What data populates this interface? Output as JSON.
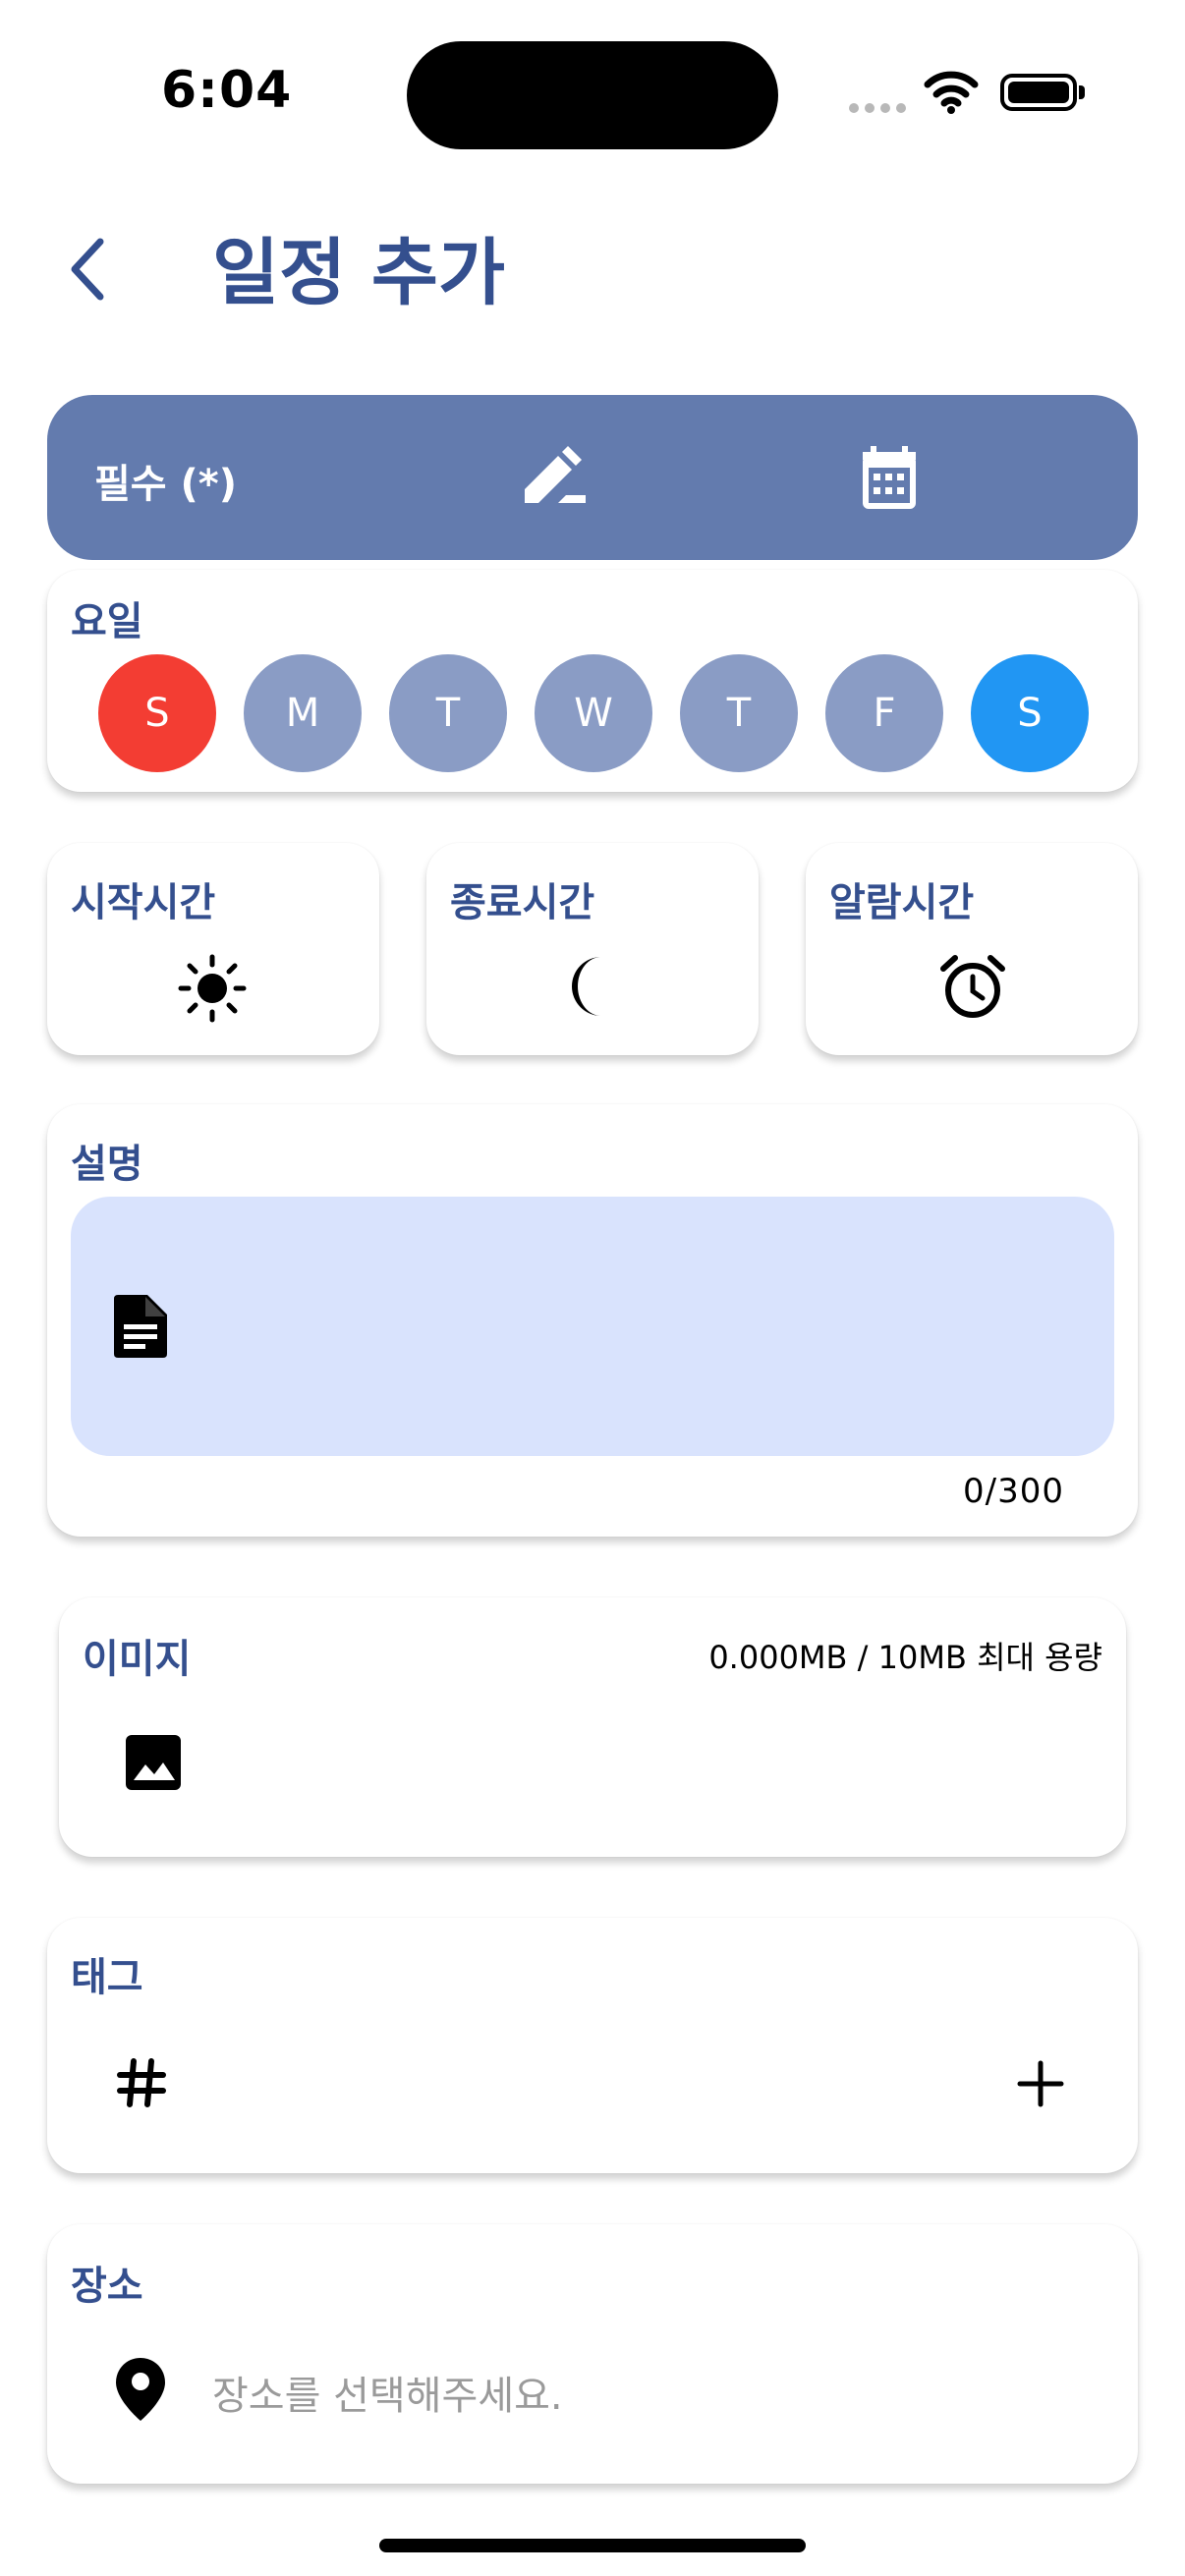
{
  "status_bar": {
    "time": "6:04"
  },
  "header": {
    "title": "일정 추가"
  },
  "required_bar": {
    "label": "필수 (*)"
  },
  "days": {
    "label": "요일",
    "items": [
      {
        "letter": "S",
        "color": "#f33d33"
      },
      {
        "letter": "M",
        "color": "#8a9cc5"
      },
      {
        "letter": "T",
        "color": "#8a9cc5"
      },
      {
        "letter": "W",
        "color": "#8a9cc5"
      },
      {
        "letter": "T",
        "color": "#8a9cc5"
      },
      {
        "letter": "F",
        "color": "#8a9cc5"
      },
      {
        "letter": "S",
        "color": "#2196f3"
      }
    ]
  },
  "times": {
    "start_label": "시작시간",
    "end_label": "종료시간",
    "alarm_label": "알람시간"
  },
  "description": {
    "label": "설명",
    "counter": "0/300"
  },
  "image": {
    "label": "이미지",
    "size_info": "0.000MB / 10MB 최대 용량"
  },
  "tags": {
    "label": "태그"
  },
  "place": {
    "label": "장소",
    "placeholder": "장소를 선택해주세요."
  },
  "colors": {
    "accent": "#344f8e",
    "bar": "#637bae",
    "input_bg": "#d9e3fd"
  }
}
